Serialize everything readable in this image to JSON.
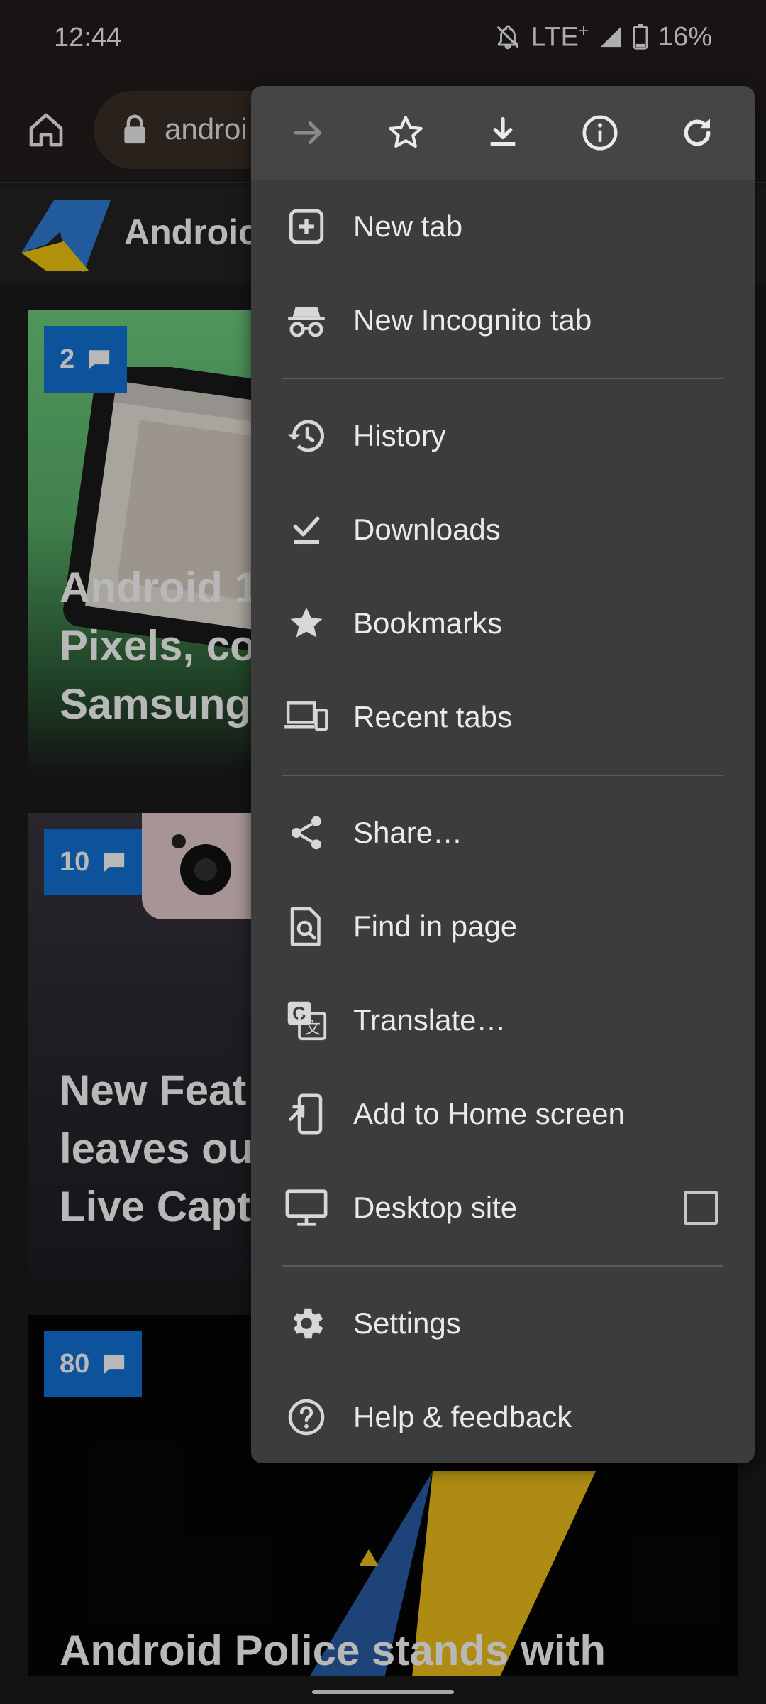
{
  "status_bar": {
    "time": "12:44",
    "network": "LTE",
    "network_sup": "+",
    "battery": "16%"
  },
  "toolbar": {
    "url_partial": "androi"
  },
  "site": {
    "title_partial": "Androic"
  },
  "articles": [
    {
      "comments": "2",
      "title_lines": [
        "Android 1",
        "Pixels, co",
        "Samsung"
      ]
    },
    {
      "comments": "10",
      "title_lines": [
        "New Feat",
        "leaves ou",
        "Live Capt"
      ]
    },
    {
      "comments": "80",
      "title_lines": [
        "Android Police stands with"
      ]
    }
  ],
  "menu": {
    "top_icons": [
      "forward-icon",
      "star-outline-icon",
      "download-icon",
      "info-icon",
      "refresh-icon"
    ],
    "items": [
      {
        "label": "New tab",
        "icon": "plus-box-icon"
      },
      {
        "label": "New Incognito tab",
        "icon": "incognito-icon"
      },
      {
        "label": "History",
        "icon": "history-icon"
      },
      {
        "label": "Downloads",
        "icon": "download-check-icon"
      },
      {
        "label": "Bookmarks",
        "icon": "star-filled-icon"
      },
      {
        "label": "Recent tabs",
        "icon": "devices-icon"
      },
      {
        "label": "Share…",
        "icon": "share-icon"
      },
      {
        "label": "Find in page",
        "icon": "find-page-icon"
      },
      {
        "label": "Translate…",
        "icon": "translate-icon"
      },
      {
        "label": "Add to Home screen",
        "icon": "add-home-icon"
      },
      {
        "label": "Desktop site",
        "icon": "desktop-icon",
        "checkbox": false
      },
      {
        "label": "Settings",
        "icon": "gear-icon"
      },
      {
        "label": "Help & feedback",
        "icon": "help-icon"
      }
    ]
  },
  "colors": {
    "menu_bg": "#3c3c3c",
    "badge": "#1373d7",
    "urlbar": "#3a2f27"
  }
}
